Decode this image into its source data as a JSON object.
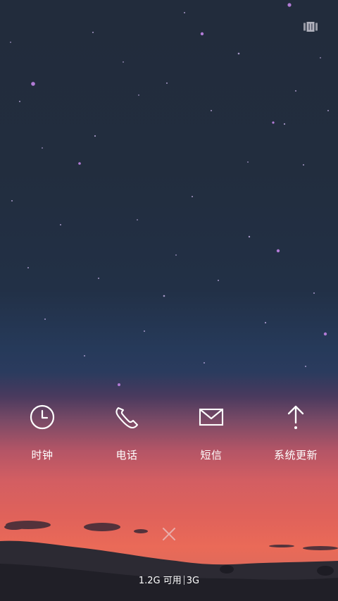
{
  "top_bar": {
    "recents_icon": "card-stack-icon"
  },
  "apps": [
    {
      "label": "时钟",
      "icon": "clock-icon"
    },
    {
      "label": "电话",
      "icon": "phone-icon"
    },
    {
      "label": "短信",
      "icon": "envelope-icon"
    },
    {
      "label": "系统更新",
      "icon": "arrow-up-icon"
    }
  ],
  "close_icon": "close-icon",
  "memory": {
    "available": "1.2G 可用",
    "network": "3G"
  },
  "colors": {
    "foreground": "#ffffff",
    "sky_top": "#222c3c",
    "sunset": "#e0625a",
    "star_purple": "#b27bd6"
  }
}
